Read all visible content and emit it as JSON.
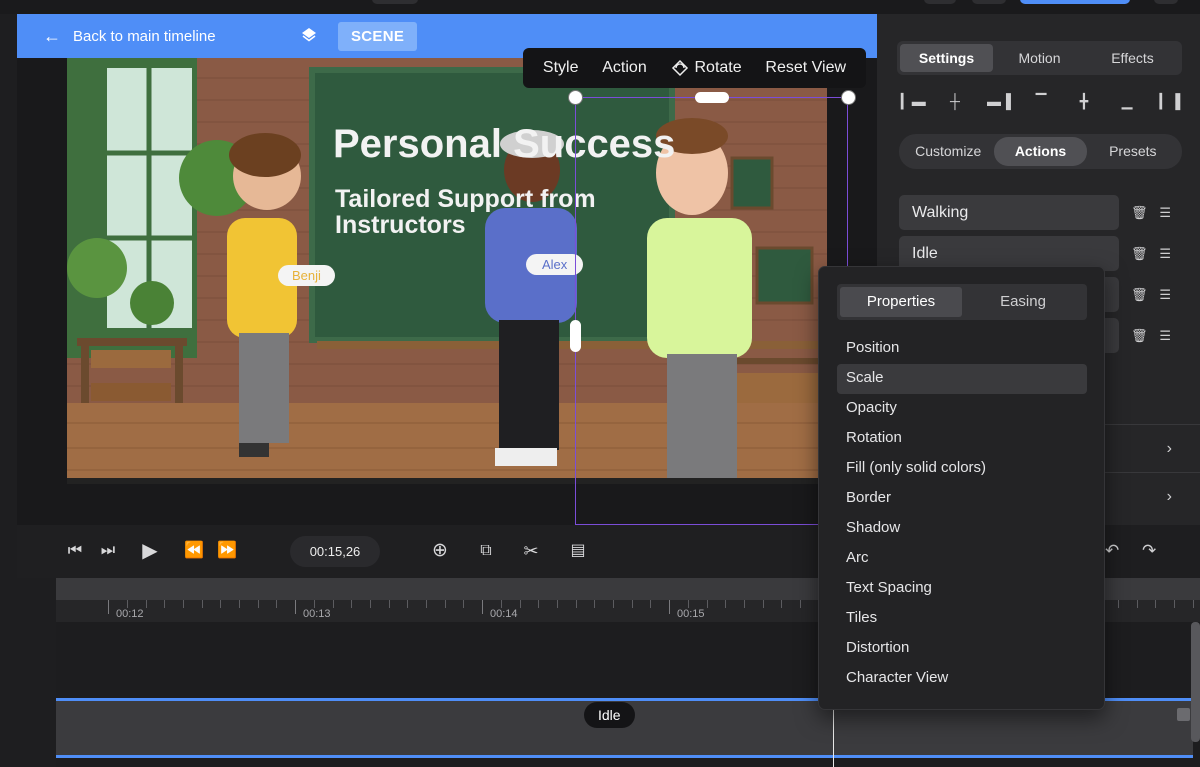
{
  "header": {
    "back_label": "Back to main timeline",
    "scene_label": "SCENE"
  },
  "float_toolbar": {
    "style": "Style",
    "action": "Action",
    "rotate": "Rotate",
    "reset_view": "Reset View"
  },
  "stage": {
    "title_line1": "Personal Success",
    "subtitle_line1": "Tailored Support from",
    "subtitle_line2": "Instructors",
    "name_tag_1": "Benji",
    "name_tag_2": "Alex"
  },
  "transport": {
    "timecode": "00:15,26"
  },
  "ruler": {
    "labels": [
      "00:12",
      "00:13",
      "00:14",
      "00:15"
    ]
  },
  "track": {
    "clip_label": "Idle"
  },
  "panel": {
    "top_tabs": [
      "Settings",
      "Motion",
      "Effects"
    ],
    "active_top_tab": "Settings",
    "sub_tabs": [
      "Customize",
      "Actions",
      "Presets"
    ],
    "active_sub_tab": "Actions",
    "actions": [
      "Walking",
      "Idle",
      "",
      ""
    ]
  },
  "dropdown": {
    "tabs": [
      "Properties",
      "Easing"
    ],
    "active_tab": "Properties",
    "items": [
      "Position",
      "Scale",
      "Opacity",
      "Rotation",
      "Fill (only solid colors)",
      "Border",
      "Shadow",
      "Arc",
      "Text Spacing",
      "Tiles",
      "Distortion",
      "Character View"
    ],
    "hover_item": "Scale"
  },
  "colors": {
    "accent": "#4f8ef7",
    "selection": "#7b4dd8",
    "board_green": "#2f5a3e",
    "brick": "#8a5a45"
  }
}
